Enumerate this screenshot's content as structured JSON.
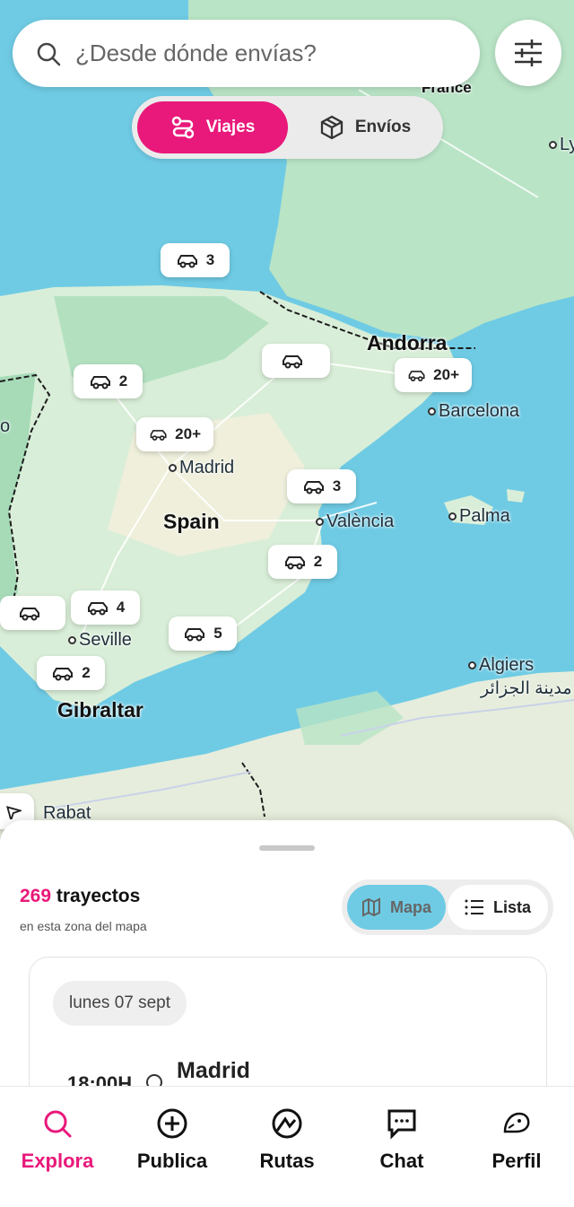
{
  "search": {
    "placeholder": "¿Desde dónde envías?"
  },
  "mode_tabs": {
    "trips": "Viajes",
    "shipments": "Envíos"
  },
  "map": {
    "places": {
      "france": "France",
      "lyon": "Ly",
      "andorra": "Andorra",
      "barcelona": "Barcelona",
      "madrid": "Madrid",
      "spain": "Spain",
      "valencia": "València",
      "palma": "Palma",
      "seville": "Seville",
      "gibraltar": "Gibraltar",
      "algiers": "Algiers",
      "algiers_ar": "مدينة الجزائر",
      "rabat": "Rabat",
      "porto": "o"
    },
    "pins": {
      "north": "3",
      "northwest": "2",
      "barcelona": "20+",
      "madrid": "20+",
      "valencia": "3",
      "murcia": "2",
      "seville_north": "4",
      "andalusia": "5",
      "cadiz": "2",
      "zaragoza": "",
      "portugal": ""
    }
  },
  "sheet": {
    "count": "269",
    "count_label": "trayectos",
    "subtitle": "en esta zona del mapa",
    "view_map": "Mapa",
    "view_list": "Lista"
  },
  "trip_card": {
    "date": "lunes 07 sept",
    "time": "18:00H",
    "origin": "Madrid"
  },
  "nav": {
    "explore": "Explora",
    "publish": "Publica",
    "routes": "Rutas",
    "chat": "Chat",
    "profile": "Perfil"
  },
  "colors": {
    "accent": "#e8197a",
    "sea": "#6fcbe4",
    "land": "#b8e3c6"
  }
}
